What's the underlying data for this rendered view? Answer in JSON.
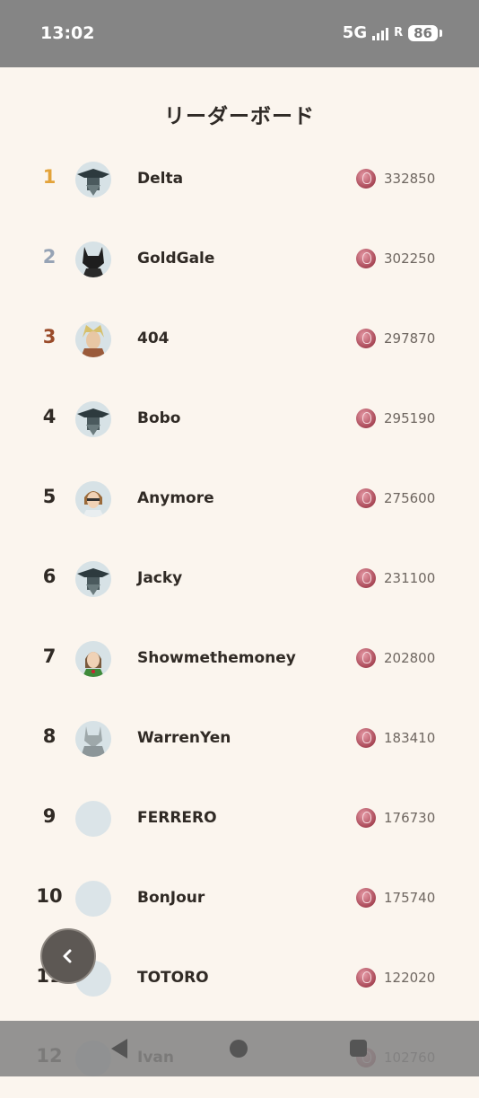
{
  "status": {
    "time": "13:02",
    "network": "5G",
    "carrier_mark": "R",
    "battery": "86"
  },
  "page": {
    "title": "リーダーボード"
  },
  "rank_colors": {
    "1": "#e3a33a",
    "2": "#96a3b5",
    "3": "#9a4b2a",
    "default": "#302a25"
  },
  "leaderboard": [
    {
      "rank": "1",
      "name": "Delta",
      "score": "332850",
      "avatar": "hat-avatar"
    },
    {
      "rank": "2",
      "name": "GoldGale",
      "score": "302250",
      "avatar": "wolf-avatar"
    },
    {
      "rank": "3",
      "name": "404",
      "score": "297870",
      "avatar": "blonde-avatar"
    },
    {
      "rank": "4",
      "name": "Bobo",
      "score": "295190",
      "avatar": "hat-avatar"
    },
    {
      "rank": "5",
      "name": "Anymore",
      "score": "275600",
      "avatar": "glasses-avatar"
    },
    {
      "rank": "6",
      "name": "Jacky",
      "score": "231100",
      "avatar": "hat-avatar"
    },
    {
      "rank": "7",
      "name": "Showmethemoney",
      "score": "202800",
      "avatar": "girl-avatar"
    },
    {
      "rank": "8",
      "name": "WarrenYen",
      "score": "183410",
      "avatar": "robot-avatar"
    },
    {
      "rank": "9",
      "name": "FERRERO",
      "score": "176730",
      "avatar": "blank-avatar"
    },
    {
      "rank": "10",
      "name": "BonJour",
      "score": "175740",
      "avatar": "blank-avatar"
    },
    {
      "rank": "11",
      "name": "TOTORO",
      "score": "122020",
      "avatar": "blank-avatar"
    },
    {
      "rank": "12",
      "name": "Ivan",
      "score": "102760",
      "avatar": "blank-avatar"
    }
  ],
  "icons": {
    "score": "coin-icon",
    "back": "chevron-left-icon"
  }
}
